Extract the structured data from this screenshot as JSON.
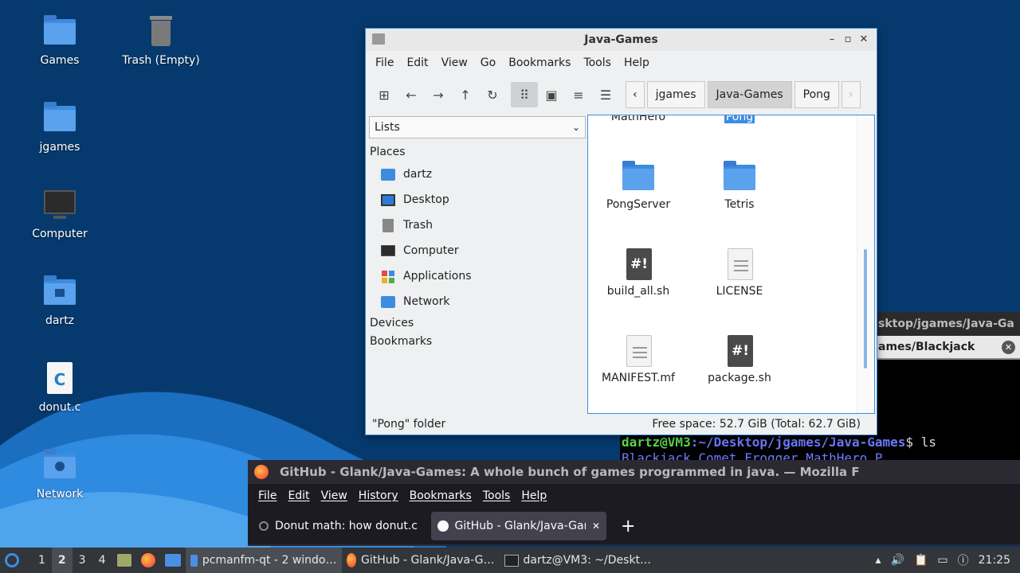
{
  "desktop_icons": [
    {
      "label": "Games"
    },
    {
      "label": "Trash (Empty)"
    },
    {
      "label": "jgames"
    },
    {
      "label": "Computer"
    },
    {
      "label": "dartz"
    },
    {
      "label": "donut.c"
    },
    {
      "label": "Network"
    }
  ],
  "file_manager": {
    "title": "Java-Games",
    "menu": [
      "File",
      "Edit",
      "View",
      "Go",
      "Bookmarks",
      "Tools",
      "Help"
    ],
    "breadcrumbs": [
      "jgames",
      "Java-Games",
      "Pong"
    ],
    "side_mode": "Lists",
    "places_heading": "Places",
    "places": [
      "dartz",
      "Desktop",
      "Trash",
      "Computer",
      "Applications",
      "Network"
    ],
    "devices_heading": "Devices",
    "bookmarks_heading": "Bookmarks",
    "files": [
      {
        "name": "MathHero"
      },
      {
        "name": "Pong"
      },
      {
        "name": "PongServer"
      },
      {
        "name": "Tetris"
      },
      {
        "name": "build_all.sh"
      },
      {
        "name": "LICENSE"
      },
      {
        "name": "MANIFEST.mf"
      },
      {
        "name": "package.sh"
      }
    ],
    "status_left": "\"Pong\" folder",
    "status_right": "Free space: 52.7 GiB (Total: 62.7 GiB)"
  },
  "terminal": {
    "title": "sktop/jgames/Java-Ga",
    "tab": "ames/Blackjack",
    "prompt_user": "dartz@VM3",
    "prompt_path": ":~/Desktop/jgames/Java-Games",
    "prompt_cmd": "$ ls",
    "output": "Blackjack     Comet      Frogger      MathHero    P"
  },
  "firefox": {
    "title": "GitHub - Glank/Java-Games: A whole bunch of games programmed in java. — Mozilla F",
    "menu": [
      "File",
      "Edit",
      "View",
      "History",
      "Bookmarks",
      "Tools",
      "Help"
    ],
    "tabs": [
      "Donut math: how donut.c",
      "GitHub - Glank/Java-Gam"
    ],
    "new_tab": "+"
  },
  "taskbar": {
    "workspaces": [
      "1",
      "2",
      "3",
      "4"
    ],
    "tasks": [
      "pcmanfm-qt - 2 windo…",
      "GitHub - Glank/Java-G…",
      "dartz@VM3: ~/Deskt…"
    ],
    "clock": "21:25"
  }
}
